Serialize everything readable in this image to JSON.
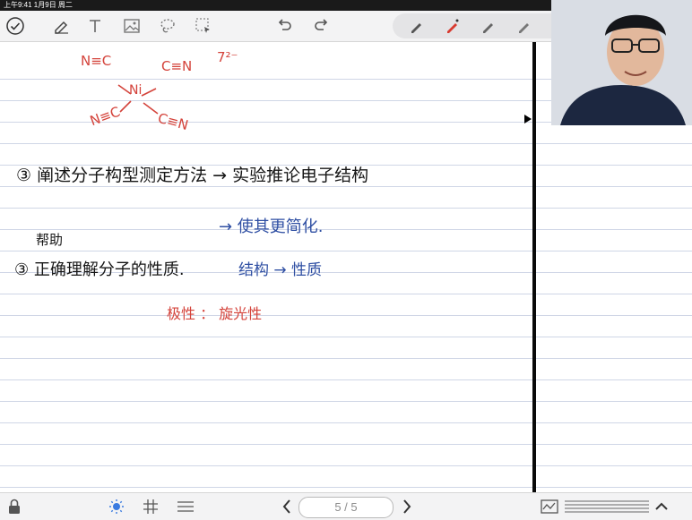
{
  "status_bar": {
    "time_date": "上午9:41   1月9日 周二"
  },
  "toolbar": {
    "tools": [
      "check-circle-icon",
      "pen-icon",
      "text-icon",
      "image-icon",
      "lasso-icon",
      "select-icon"
    ],
    "undo_icon": "undo-icon",
    "redo_icon": "redo-icon",
    "pens": [
      "pen-icon",
      "highlighter-icon",
      "pencil-icon",
      "marker-icon",
      "eraser-icon"
    ],
    "active_pen_color": "#d83b30"
  },
  "notes": {
    "complex_charge": "7²⁻",
    "ligand_top_left": "N≡C",
    "ligand_top_right": "C≡N",
    "ligand_bottom_left": "N≡C",
    "ligand_bottom_right": "C≡N",
    "center_atom": "Ni",
    "line2": "③ 阐述分子构型测定方法 → 实验推论电子结构",
    "line3": "→ 使其更简化.",
    "line4_note": "帮助",
    "line4": "③ 正确理解分子的性质.",
    "line4_blue": "结构 → 性质",
    "line5": "极性 ： 旋光性",
    "colors": {
      "ink_black": "#161616",
      "ink_blue": "#2f4fa3",
      "ink_red": "#d4433b"
    }
  },
  "bottom_bar": {
    "lock_icon": "lock-icon",
    "brightness_icon": "brightness-icon",
    "grid_icon": "grid-icon",
    "list_icon": "list-icon",
    "page_indicator": "5 / 5",
    "prev_icon": "chevron-left-icon",
    "next_icon": "chevron-right-icon",
    "right_icons": [
      "chart-icon",
      "lines-icon",
      "chevron-up-icon"
    ]
  }
}
